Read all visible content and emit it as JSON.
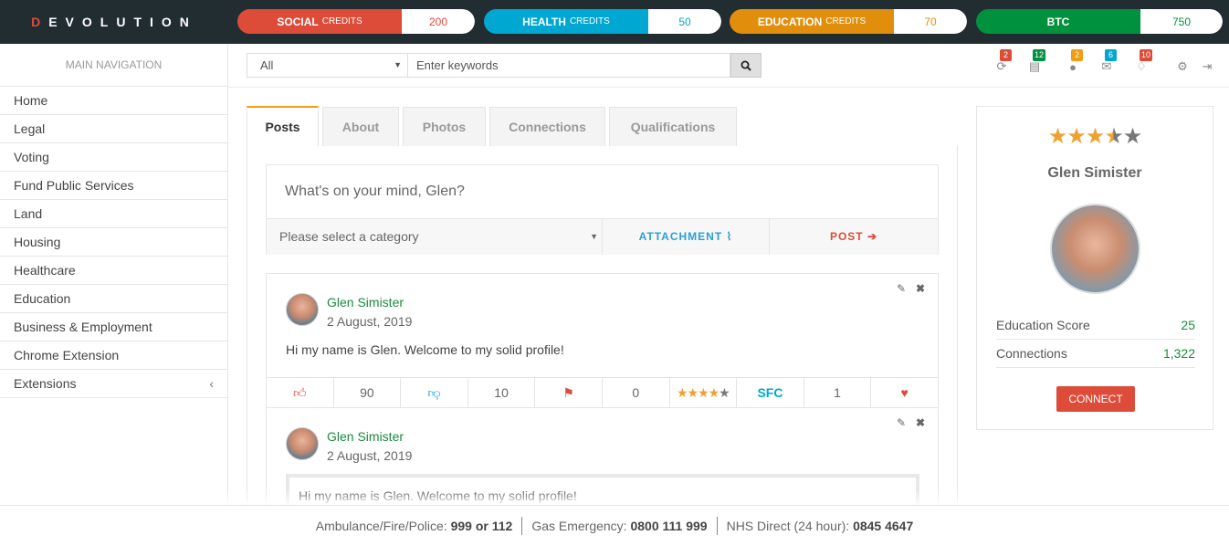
{
  "brand": {
    "first": "D",
    "rest": "EVOLUTION"
  },
  "credits": [
    {
      "label": "SOCIAL",
      "sub": "CREDITS",
      "value": "200",
      "color": "#dd4b39"
    },
    {
      "label": "HEALTH",
      "sub": "CREDITS",
      "value": "50",
      "color": "#00a7d0"
    },
    {
      "label": "EDUCATION",
      "sub": "CREDITS",
      "value": "70",
      "color": "#e08e0b"
    },
    {
      "label": "BTC",
      "sub": "",
      "value": "750",
      "color": "#00913f"
    }
  ],
  "nav": {
    "heading": "MAIN NAVIGATION",
    "items": [
      "Home",
      "Legal",
      "Voting",
      "Fund Public Services",
      "Land",
      "Housing",
      "Healthcare",
      "Education",
      "Business & Employment",
      "Chrome Extension",
      "Extensions"
    ],
    "expand_glyph": "‹"
  },
  "search": {
    "category": "All",
    "placeholder": "Enter keywords"
  },
  "notifications": [
    {
      "icon": "refresh-icon",
      "count": "2",
      "color": "#dd4b39"
    },
    {
      "icon": "newspaper-icon",
      "count": "12",
      "color": "#00913f"
    },
    {
      "icon": "user-icon",
      "count": "2",
      "color": "#f39c12"
    },
    {
      "icon": "envelope-icon",
      "count": "6",
      "color": "#00a7d0"
    },
    {
      "icon": "bell-icon",
      "count": "10",
      "color": "#dd4b39"
    }
  ],
  "tabs": [
    "Posts",
    "About",
    "Photos",
    "Connections",
    "Qualifications"
  ],
  "composer": {
    "placeholder": "What's on your mind, Glen?",
    "category_placeholder": "Please select a category",
    "attachment": "ATTACHMENT",
    "post": "POST"
  },
  "posts": [
    {
      "author": "Glen Simister",
      "date": "2 August, 2019",
      "text": "Hi my name is Glen. Welcome to my solid profile!",
      "likes": "90",
      "dislikes": "10",
      "flags": "0",
      "rating": 4,
      "sfc_label": "SFC",
      "sfc": "1"
    },
    {
      "author": "Glen Simister",
      "date": "2 August, 2019",
      "quote": "Hi my name is Glen. Welcome to my solid profile!"
    }
  ],
  "profile": {
    "rating": 3.5,
    "name": "Glen Simister",
    "stats": [
      {
        "label": "Education Score",
        "value": "25"
      },
      {
        "label": "Connections",
        "value": "1,322"
      }
    ],
    "connect": "CONNECT"
  },
  "footer": [
    {
      "label": "Ambulance/Fire/Police:",
      "value": "999 or 112"
    },
    {
      "label": "Gas Emergency:",
      "value": "0800 111 999"
    },
    {
      "label": "NHS Direct (24 hour):",
      "value": "0845 4647"
    }
  ]
}
